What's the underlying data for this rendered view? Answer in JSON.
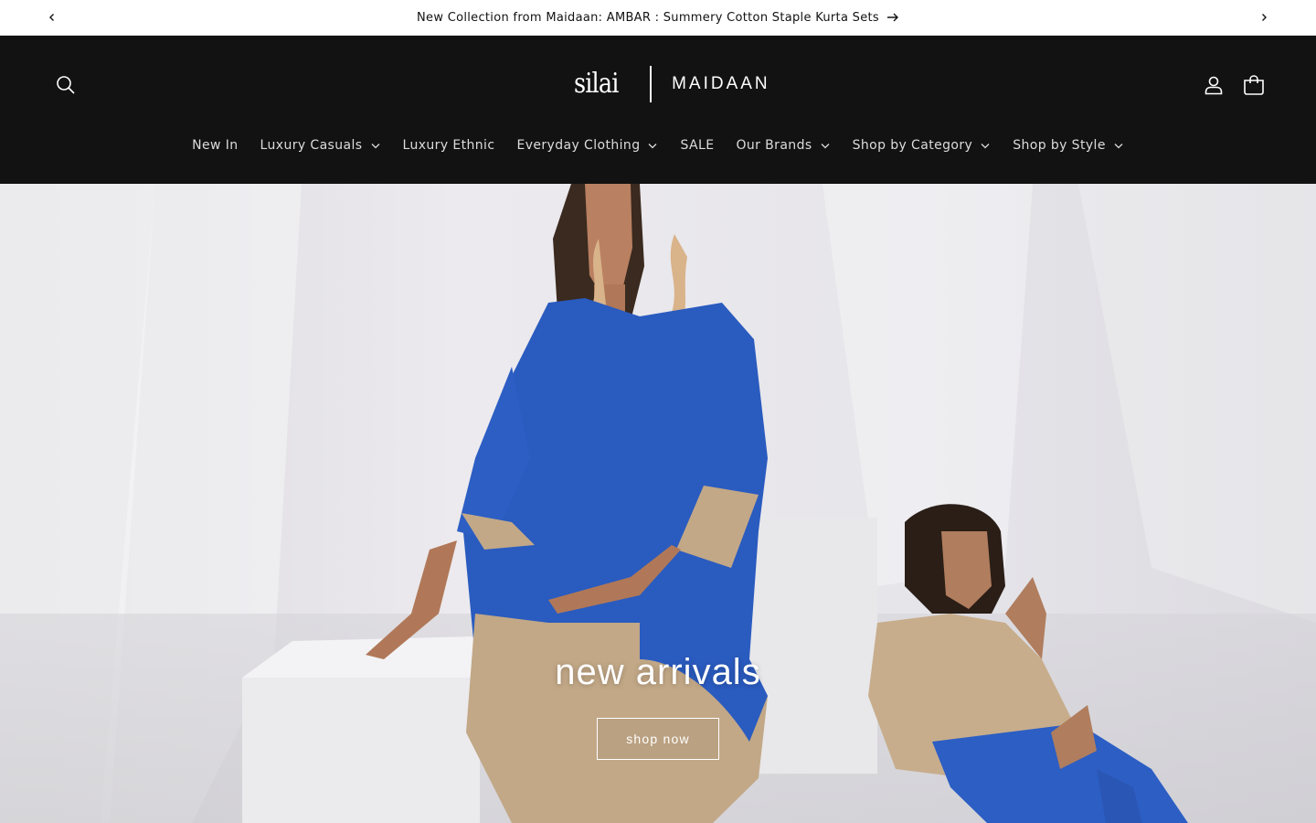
{
  "announcement": {
    "text": "New Collection from Maidaan: AMBAR : Summery Cotton Staple Kurta Sets"
  },
  "header": {
    "logo_mark": "silai",
    "logo_brand": "MAIDAAN"
  },
  "nav": {
    "items": [
      {
        "label": "New In",
        "has_dropdown": false
      },
      {
        "label": "Luxury Casuals",
        "has_dropdown": true
      },
      {
        "label": "Luxury Ethnic",
        "has_dropdown": false
      },
      {
        "label": "Everyday Clothing",
        "has_dropdown": true
      },
      {
        "label": "SALE",
        "has_dropdown": false
      },
      {
        "label": "Our Brands",
        "has_dropdown": true
      },
      {
        "label": "Shop by Category",
        "has_dropdown": true
      },
      {
        "label": "Shop by Style",
        "has_dropdown": true
      }
    ]
  },
  "hero": {
    "title": "new arrivals",
    "button_label": "shop now"
  },
  "colors": {
    "header_bg": "#121212",
    "announce_bg": "#ffffff",
    "nav_text": "#dcdcdc",
    "dress_blue": "#2a5bbf",
    "dress_tan": "#c2a887"
  },
  "icons": {
    "prev": "chevron-left-icon",
    "next": "chevron-right-icon",
    "announce_arrow": "arrow-right-icon",
    "search": "search-icon",
    "account": "user-icon",
    "cart": "bag-icon",
    "dropdown": "chevron-down-icon"
  }
}
